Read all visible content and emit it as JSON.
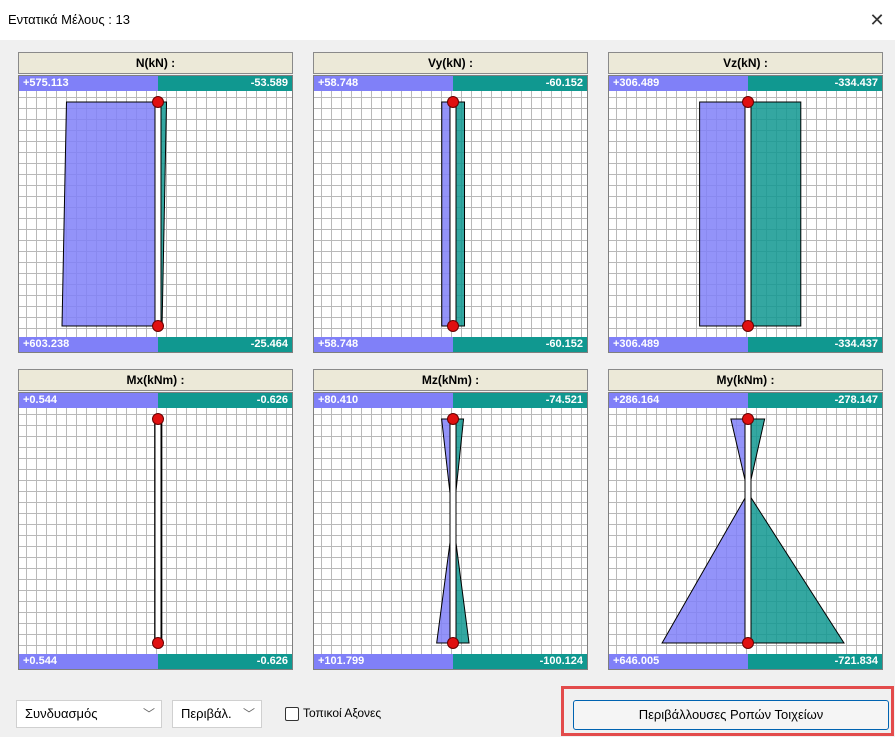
{
  "window": {
    "title": "Εντατικά Μέλους : 13",
    "close_glyph": "✕"
  },
  "colors": {
    "positive": "#8080f8",
    "negative": "#109890",
    "grid": "#b9b9b9",
    "member": "#ffffff",
    "node": "#e01010"
  },
  "panels": [
    {
      "id": "n",
      "title": "N(kN) :",
      "top_pos": "+575.113",
      "top_neg": "-53.589",
      "bot_pos": "+603.238",
      "bot_neg": "-25.464",
      "pos_top_value": 575.113,
      "neg_top_value": 53.589,
      "pos_bot_value": 603.238,
      "neg_bot_value": 25.464
    },
    {
      "id": "vy",
      "title": "Vy(kN) :",
      "top_pos": "+58.748",
      "top_neg": "-60.152",
      "bot_pos": "+58.748",
      "bot_neg": "-60.152",
      "pos_top_value": 58.748,
      "neg_top_value": 60.152,
      "pos_bot_value": 58.748,
      "neg_bot_value": 60.152
    },
    {
      "id": "vz",
      "title": "Vz(kN) :",
      "top_pos": "+306.489",
      "top_neg": "-334.437",
      "bot_pos": "+306.489",
      "bot_neg": "-334.437",
      "pos_top_value": 306.489,
      "neg_top_value": 334.437,
      "pos_bot_value": 306.489,
      "neg_bot_value": 334.437
    },
    {
      "id": "mx",
      "title": "Mx(kNm) :",
      "top_pos": "+0.544",
      "top_neg": "-0.626",
      "bot_pos": "+0.544",
      "bot_neg": "-0.626",
      "pos_top_value": 0.544,
      "neg_top_value": 0.626,
      "pos_bot_value": 0.544,
      "neg_bot_value": 0.626
    },
    {
      "id": "mz",
      "title": "Mz(kNm) :",
      "top_pos": "+80.410",
      "top_neg": "-74.521",
      "bot_pos": "+101.799",
      "bot_neg": "-100.124",
      "pos_top_value": 80.41,
      "neg_top_value": 74.521,
      "pos_bot_value": 101.799,
      "neg_bot_value": 100.124
    },
    {
      "id": "my",
      "title": "My(kNm) :",
      "top_pos": "+286.164",
      "top_neg": "-278.147",
      "bot_pos": "+646.005",
      "bot_neg": "-721.834",
      "pos_top_value": 286.164,
      "neg_top_value": 278.147,
      "pos_bot_value": 646.005,
      "neg_bot_value": 721.834
    }
  ],
  "controls": {
    "combination_select": "Συνδυασμός",
    "envelope_select": "Περιβάλ.",
    "local_axes_label": "Τοπικοί Αξονες",
    "local_axes_checked": false,
    "envelopes_button": "Περιβάλλουσες Ροπών Τοιχείων"
  }
}
